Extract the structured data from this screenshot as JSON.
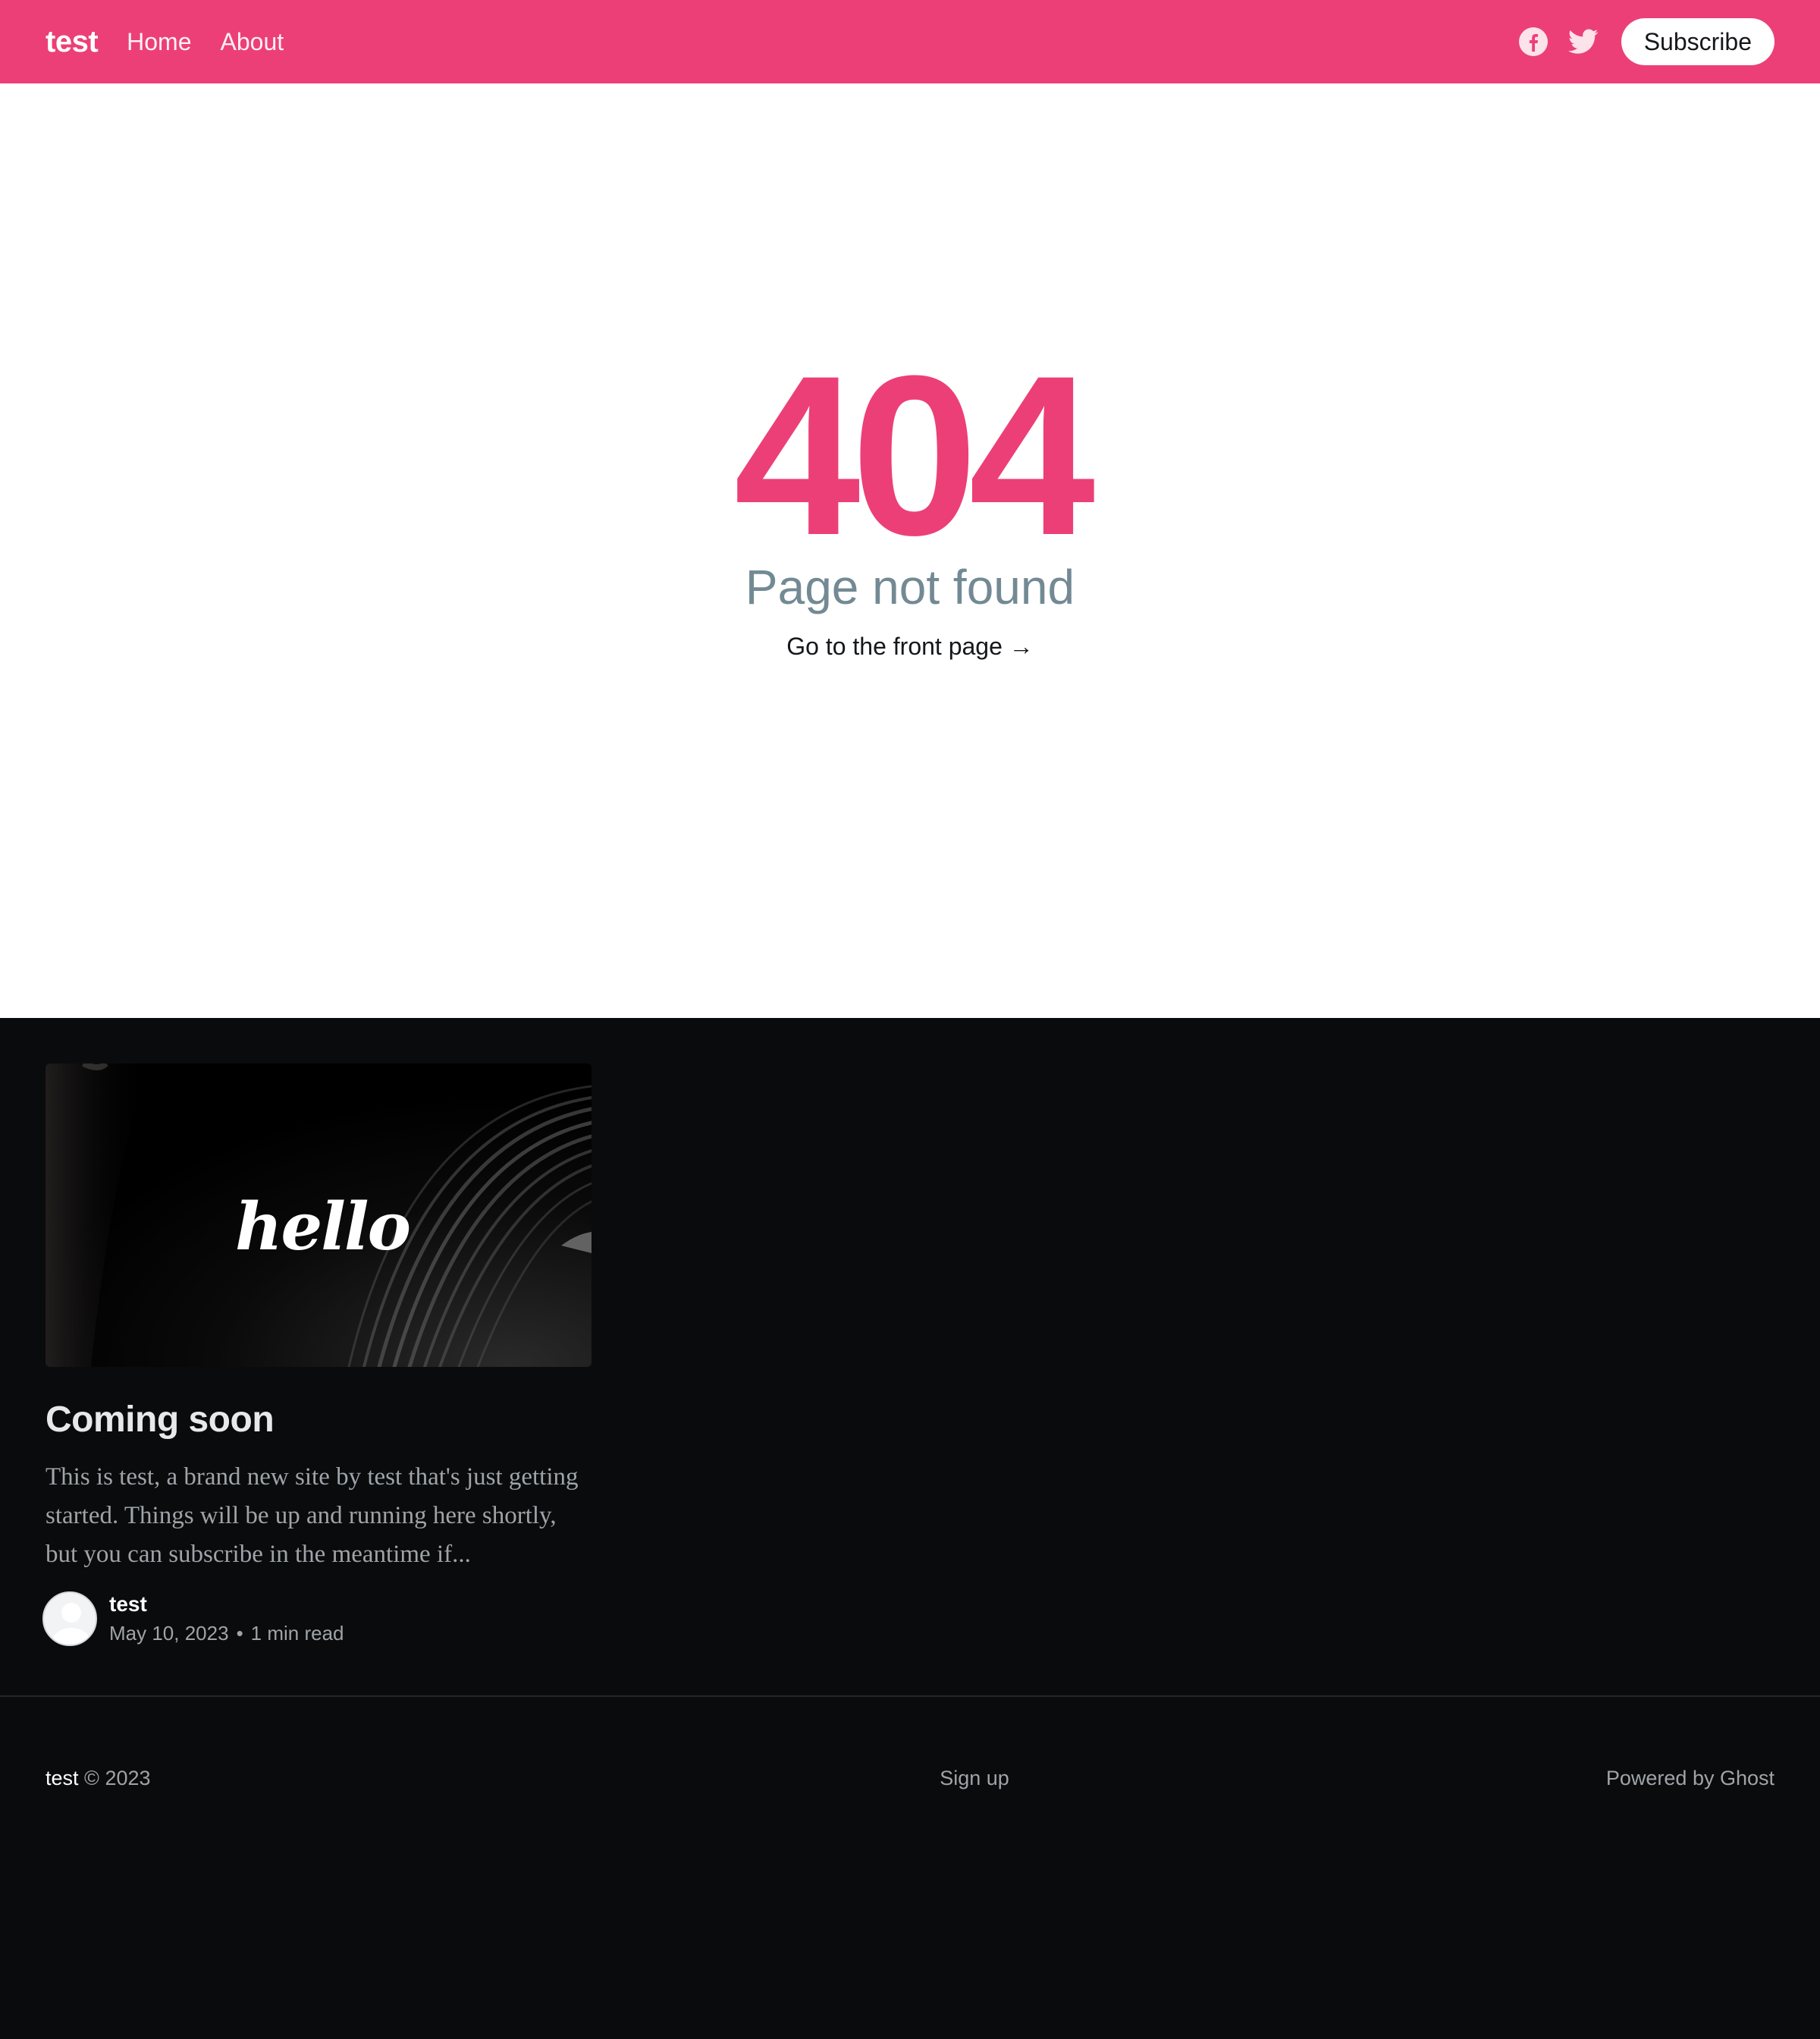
{
  "header": {
    "logo": "test",
    "nav": [
      {
        "label": "Home"
      },
      {
        "label": "About"
      }
    ],
    "social_icons": [
      "facebook-icon",
      "twitter-icon"
    ],
    "subscribe_label": "Subscribe"
  },
  "colors": {
    "accent": "#ec3f78",
    "dark_bg": "#0a0b0d",
    "muted": "#738a94"
  },
  "error": {
    "code": "404",
    "description": "Page not found",
    "link": "Go to the front page →"
  },
  "post": {
    "image_text": "hello",
    "title": "Coming soon",
    "excerpt": "This is test, a brand new site by test that's just getting started. Things will be up and running here shortly, but you can subscribe in the meantime if...",
    "author": "test",
    "date": "May 10, 2023",
    "separator": "•",
    "read_time": "1 min read"
  },
  "footer": {
    "site": "test",
    "copyright": "© 2023",
    "signup": "Sign up",
    "powered_by": "Powered by Ghost"
  }
}
